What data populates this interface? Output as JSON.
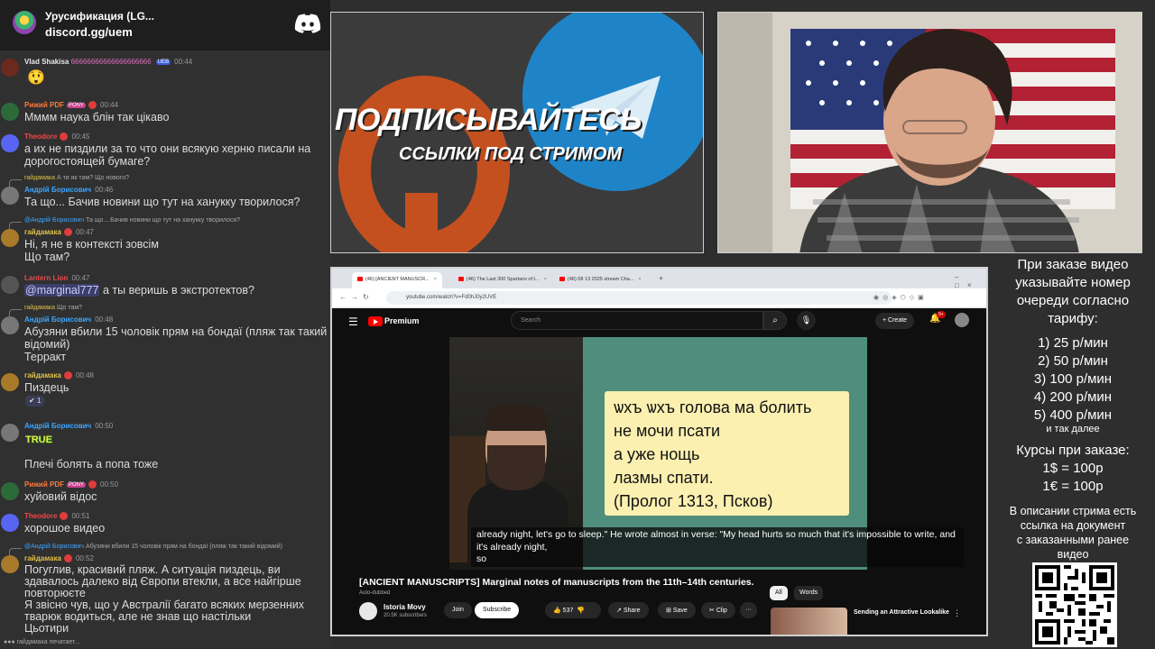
{
  "chat": {
    "server_name": "Урусификация (LG...",
    "server_link": "discord.gg/uem",
    "messages": [
      {
        "user": "Vlad Shakisa",
        "time": "00:44",
        "text": "",
        "extra": "66666666666666666666"
      },
      {
        "user": "Рижий PDF",
        "time": "00:44",
        "text": "Мммм наука блін так цікаво",
        "tag": "PONY"
      },
      {
        "user": "Theodore",
        "time": "00:45",
        "text": "а их не пиздили за то что они всякую херню писали на дорогостоящей бумаге?"
      },
      {
        "user": "Андрій Борисович",
        "time": "00:46",
        "text": "Та що... Бачив новини що тут на ханукку творилося?",
        "reply_to": "гайдамака",
        "reply_text": "А ти як там? Що нового?"
      },
      {
        "user": "гайдамака",
        "time": "00:47",
        "text": "Ні, я не в контексті зовсім\nЩо там?",
        "reply_to": "@Андрій Борисович",
        "reply_text": "Та що... Бачив новини що тут на ханукку творилося?"
      },
      {
        "user": "Lantern Lion",
        "time": "00:47",
        "text_before": "",
        "mention": "@marginal777",
        "text": " а ты веришь в экстротектов?"
      },
      {
        "user": "Андрій Борисович",
        "time": "00:48",
        "text": "Абузяни вбили 15 чоловік прям на бондаї (пляж так такий відомий)\nТерракт",
        "reply_to": "гайдамака",
        "reply_text": "Що там?"
      },
      {
        "user": "гайдамака",
        "time": "00:48",
        "text": "Пиздець",
        "reaction": "1"
      },
      {
        "user": "Андрій Борисович",
        "time": "00:50",
        "text": "Плечі болять а попа тоже",
        "sticker": "TRUE"
      },
      {
        "user": "Рижий PDF",
        "time": "00:50",
        "text": "хуйовий відос",
        "tag": "PONY"
      },
      {
        "user": "Theodore",
        "time": "00:51",
        "text": "хорошое видео"
      },
      {
        "user": "гайдамака",
        "time": "00:52",
        "text": "Погуглив, красивий пляж. А ситуація пиздець, ви здавалось далеко від Європи втекли, а все найгірше повторюєте\nЯ звісно чув, що у Австралії багато всяких мерзенних тварюк водиться, але не знав що настільки\nЦьотири",
        "reply_to": "@Андрій Борисович",
        "reply_text": "Абузяни вбили 15 чоловік прям на бондаї (пляж так такий відомий)"
      }
    ],
    "typing": "гайдамака печатает..."
  },
  "promo": {
    "title": "ПОДПИСЫВАЙТЕСЬ",
    "subtitle": "ССЫЛКИ ПОД СТРИМОМ"
  },
  "browser": {
    "tabs": [
      "(46) [ANCIENT MANUSCR...",
      "(46) The Last 300 Spartans of t...",
      "(46) 08 13 2025 stream Cha..."
    ],
    "url": "youtube.com/watch?v=Fd0hJ0y2UVE"
  },
  "youtube": {
    "brand": "Premium",
    "search_placeholder": "Search",
    "create_label": "Create",
    "notifications": "9+",
    "slide_lines": [
      "ѡхъ ѡхъ голова ма болить",
      "не мочи псати",
      "а уже нощь",
      "лазмы спати.",
      "(Пролог 1313, Псков)"
    ],
    "captions": "already night, let's go to sleep.\" He wrote almost in verse: \"My head hurts so much that it's impossible to write, and it's already night,\nso",
    "video_title": "[ANCIENT MANUSCRIPTS] Marginal notes of manuscripts from the 11th–14th centuries.",
    "auto_dubbed": "Auto-dubbed",
    "channel": "Istoria Movy",
    "subscribers": "20.5K subscribers",
    "join": "Join",
    "subscribe": "Subscribe",
    "likes": "537",
    "share": "Share",
    "save": "Save",
    "clip": "Clip",
    "more": "···",
    "filters": [
      "All",
      "Words"
    ],
    "rec_title": "Sending an Attractive Lookalike"
  },
  "info": {
    "lines": [
      "При заказе видео",
      "указывайте номер",
      "очереди согласно",
      "тарифу:"
    ],
    "prices": [
      "1) 25 р/мин",
      "2) 50 р/мин",
      "3) 100 р/мин",
      "4) 200 р/мин",
      "5) 400 р/мин"
    ],
    "etc": "и так далее",
    "courses": [
      "Курсы при заказе:",
      "1$ = 100р",
      "1€ = 100р"
    ],
    "desc": [
      "В описании стрима есть",
      "ссылка на документ",
      "с заказанными ранее",
      "видео"
    ]
  },
  "colors": {
    "accent_red": "#e03c3c",
    "discord_blue": "#5865f2",
    "telegram": "#1f84c7",
    "boosty": "#c4501f"
  }
}
